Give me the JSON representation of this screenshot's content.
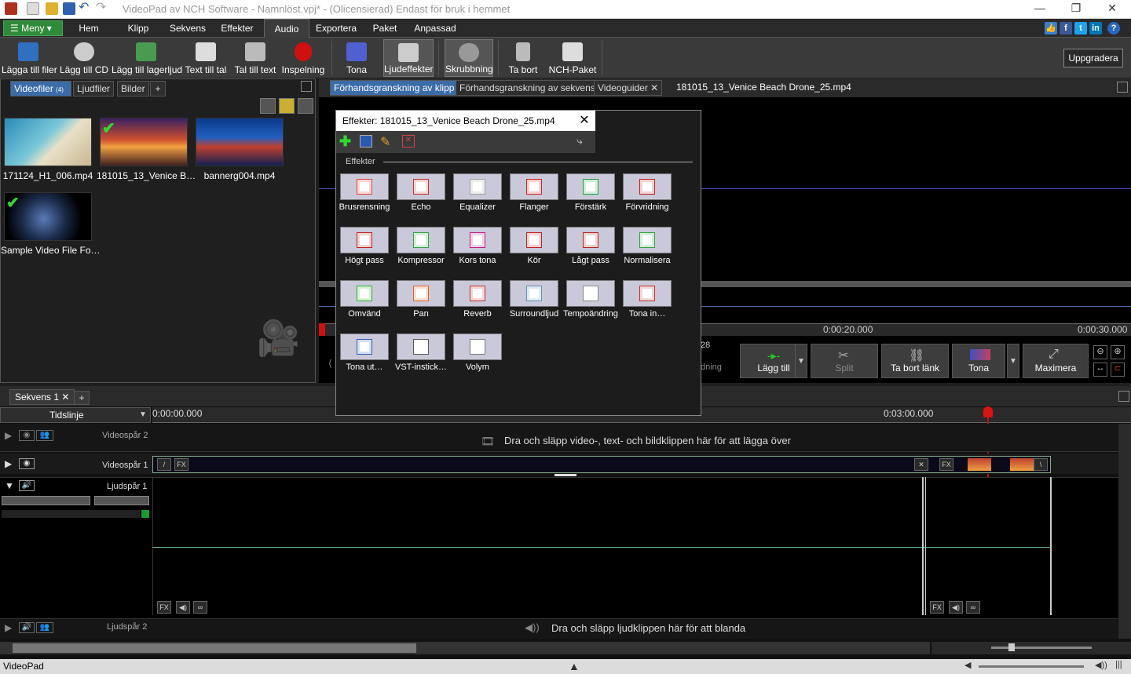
{
  "title_bar": {
    "text": "VideoPad av NCH Software - Namnlöst.vpj* - (Olicensierad) Endast för bruk i hemmet"
  },
  "menu": {
    "menu_button": "Meny",
    "tabs": [
      "Hem",
      "Klipp",
      "Sekvens",
      "Effekter",
      "Audio",
      "Exportera",
      "Paket",
      "Anpassad"
    ],
    "active_tab": "Audio"
  },
  "toolbar": {
    "buttons": [
      "Lägga till filer",
      "Lägg till CD",
      "Lägg till lagerljud",
      "Text till tal",
      "Tal till text",
      "Inspelning",
      "Tona",
      "Ljudeffekter",
      "Skrubbning",
      "Ta bort",
      "NCH-Paket"
    ],
    "upgrade": "Uppgradera"
  },
  "bin": {
    "tabs": [
      "Videofiler",
      "Ljudfiler",
      "Bilder",
      "+"
    ],
    "items": [
      "171124_H1_006.mp4",
      "181015_13_Venice B…",
      "bannerg004.mp4",
      "Sample Video File Fo…"
    ]
  },
  "preview": {
    "tabs": [
      "Förhandsgranskning av klipp",
      "Förhandsgranskning av sekvens",
      "Videoguider"
    ],
    "clip_name": "181015_13_Venice Beach Drone_25.mp4",
    "time_20": "0:00:20.000",
    "time_30": "0:00:30.000",
    "frame_num": "28",
    "partial_label": "dning",
    "buttons": [
      "Lägg till",
      "Split",
      "Ta bort länk",
      "Tona",
      "Maximera"
    ]
  },
  "effects_dialog": {
    "title": "Effekter: 181015_13_Venice Beach Drone_25.mp4",
    "section": "Effekter",
    "items": [
      "Brusrensning",
      "Echo",
      "Equalizer",
      "Flanger",
      "Förstärk",
      "Förvridning",
      "Högt pass",
      "Kompressor",
      "Kors tona",
      "Kör",
      "Lågt pass",
      "Normalisera",
      "Omvänd",
      "Pan",
      "Reverb",
      "Surroundljud",
      "Tempoändring",
      "Tona in…",
      "Tona ut…",
      "VST-instick…",
      "Volym"
    ]
  },
  "timeline": {
    "sequence_tab": "Sekvens 1",
    "timeline_label": "Tidslinje",
    "time_start": "0:00:00.000",
    "time_mid": "0:03:00.000",
    "tracks": {
      "video2": "Videospår 2",
      "video1": "Videospår 1",
      "audio1": "Ljudspår 1",
      "audio2": "Ljudspår 2"
    },
    "drop_video": "Dra och släpp video-, text- och bildklippen här för att lägga över",
    "drop_audio": "Dra och släpp ljudklippen här för att blanda"
  },
  "status_bar": {
    "app": "VideoPad"
  }
}
